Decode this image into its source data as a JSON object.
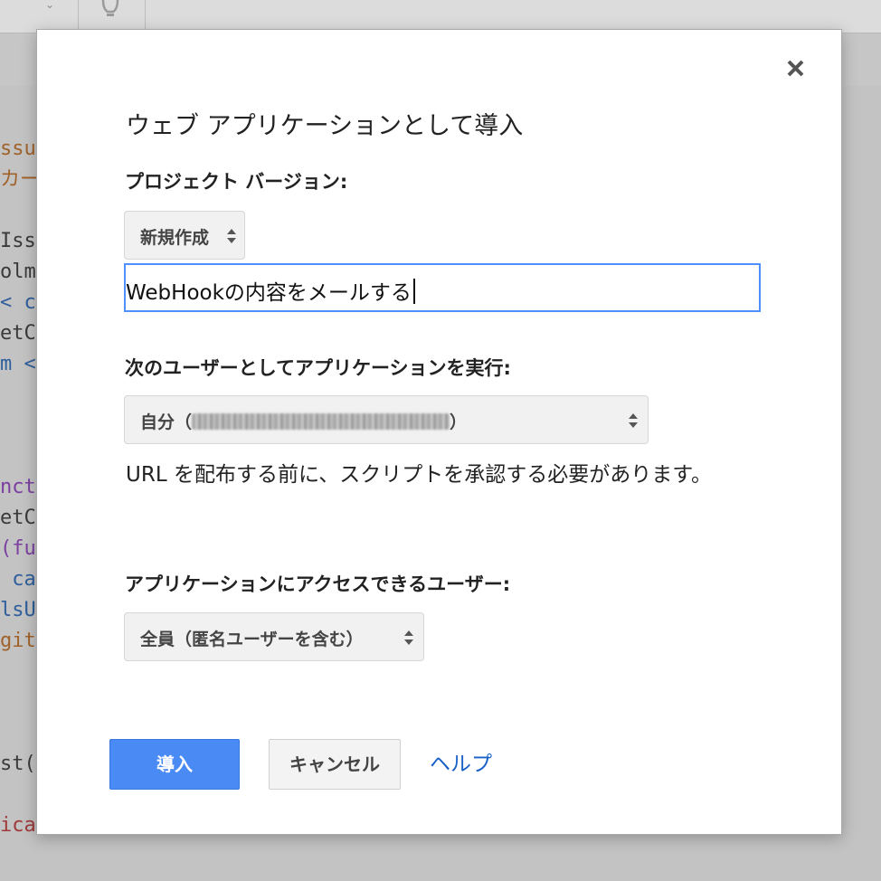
{
  "editor": {
    "code_lines": [
      {
        "text": "ssu",
        "color": "orange",
        "row": 0
      },
      {
        "text": "カー",
        "color": "orange",
        "row": 1
      },
      {
        "text": "Iss",
        "color": "dark",
        "row": 3
      },
      {
        "text": "olm",
        "color": "dark",
        "row": 4
      },
      {
        "text": "< c",
        "color": "blue",
        "row": 5
      },
      {
        "text": "etC",
        "color": "dark",
        "row": 6
      },
      {
        "text": "m <",
        "color": "blue",
        "row": 7
      },
      {
        "text": "nct",
        "color": "purple",
        "row": 11
      },
      {
        "text": "etC",
        "color": "dark",
        "row": 12
      },
      {
        "text": "(fu",
        "color": "purple",
        "row": 13
      },
      {
        "text": " ca",
        "color": "blue",
        "row": 14
      },
      {
        "text": "lsU",
        "color": "blue",
        "row": 15
      },
      {
        "text": "git",
        "color": "orange",
        "row": 16
      },
      {
        "text": "st(",
        "color": "dark",
        "row": 20
      },
      {
        "text": "ica",
        "color": "red",
        "row": 22
      }
    ]
  },
  "dialog": {
    "title": "ウェブ アプリケーションとして導入",
    "close_icon": "close-icon",
    "project_version": {
      "label": "プロジェクト バージョン:",
      "selected": "新規作成"
    },
    "version_description": {
      "value": "WebHookの内容をメールする"
    },
    "execute_as": {
      "label": "次のユーザーとしてアプリケーションを実行:",
      "selected_prefix": "自分（",
      "selected_suffix": "）"
    },
    "notice": "URL を配布する前に、スクリプトを承認する必要があります。",
    "access": {
      "label": "アプリケーションにアクセスできるユーザー:",
      "selected": "全員（匿名ユーザーを含む）"
    },
    "buttons": {
      "deploy": "導入",
      "cancel": "キャンセル",
      "help": "ヘルプ"
    }
  }
}
